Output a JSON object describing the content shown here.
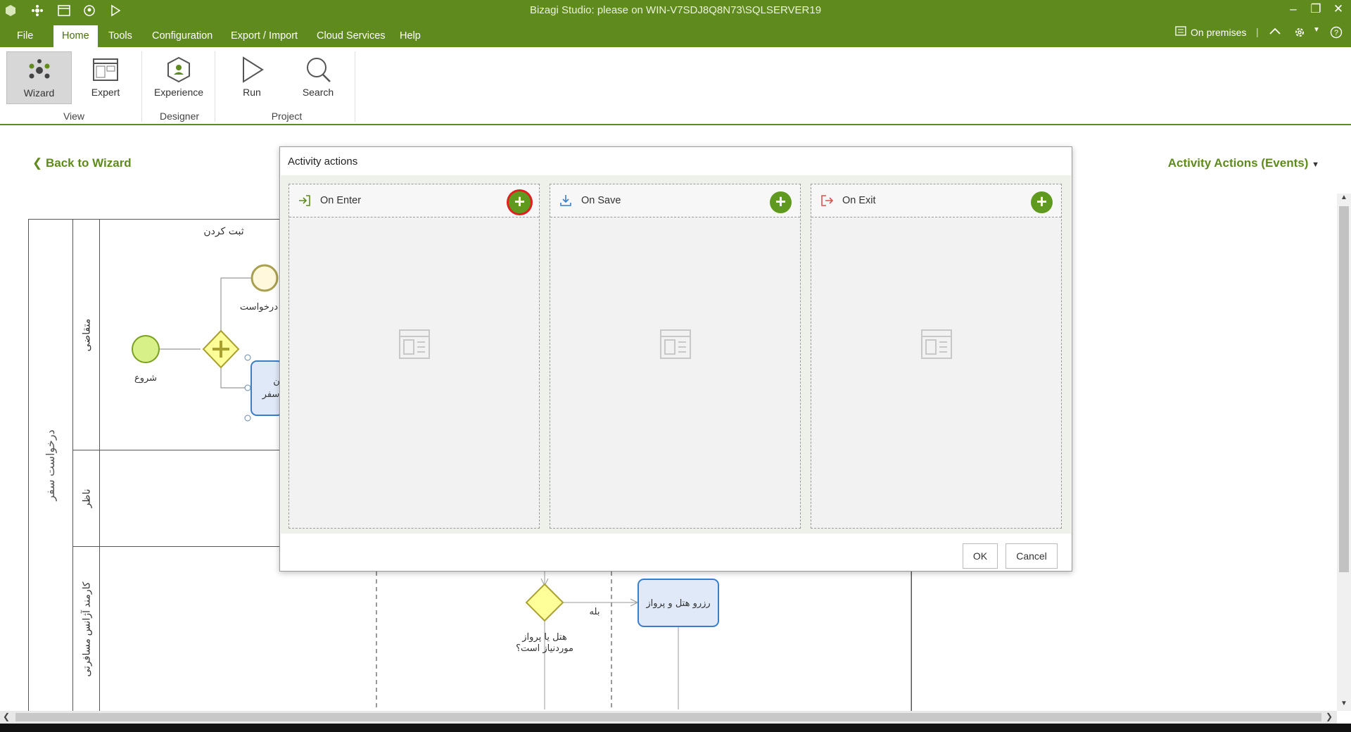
{
  "window": {
    "title": "Bizagi Studio: please  on WIN-V7SDJ8Q8N73\\SQLSERVER19"
  },
  "menu": {
    "items": [
      "File",
      "Home",
      "Tools",
      "Configuration",
      "Export / Import",
      "Cloud Services",
      "Help"
    ],
    "active": "Home",
    "on_premises": "On premises"
  },
  "ribbon": {
    "buttons": [
      {
        "label": "Wizard",
        "icon": "wizard-icon",
        "selected": true
      },
      {
        "label": "Expert",
        "icon": "expert-icon"
      },
      {
        "label": "Experience",
        "icon": "experience-icon"
      },
      {
        "label": "Run",
        "icon": "run-icon"
      },
      {
        "label": "Search",
        "icon": "search-icon"
      }
    ],
    "groups": [
      "View",
      "Designer",
      "Project"
    ]
  },
  "nav": {
    "back_label": "Back to Wizard",
    "event_selector": "Activity Actions (Events)"
  },
  "diagram": {
    "pool_label": "درخواست سفر",
    "lanes": [
      "متقاضی",
      "ناظر",
      "کارمند آژانس مسافرتی"
    ],
    "phase_label": "ثبت کردن",
    "start_label": "شروع",
    "end_label_partial": "درخواست",
    "task_partial_top": "ن",
    "task_partial_bottom": "سفر",
    "gateway_label_line1": "هتل یا پرواز",
    "gateway_label_line2": "موردنیاز است؟",
    "flow_label_yes": "بله",
    "task_booking": "رزرو هتل و پرواز"
  },
  "dialog": {
    "title": "Activity actions",
    "columns": [
      {
        "label": "On Enter",
        "icon": "enter-icon",
        "accent": "#5f8a1e"
      },
      {
        "label": "On Save",
        "icon": "download-icon",
        "accent": "#3a7dc9"
      },
      {
        "label": "On Exit",
        "icon": "exit-icon",
        "accent": "#d9534f"
      }
    ],
    "ok_label": "OK",
    "cancel_label": "Cancel"
  },
  "colors": {
    "brand": "#5f8a1e",
    "add_button": "#5f9a1f",
    "highlight": "#e02020"
  }
}
